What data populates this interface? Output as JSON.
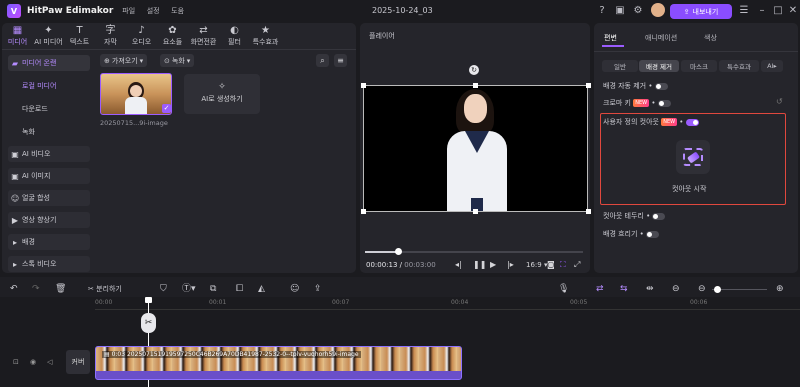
{
  "app": {
    "logo_letter": "V",
    "name": "HitPaw Edimakor",
    "menu": [
      "파일",
      "설정",
      "도움"
    ],
    "project_title": "2025-10-24_03",
    "export_label": "내보내기",
    "avatar": "avatar"
  },
  "colors": {
    "accent": "#8a4dff",
    "panel": "#25252b",
    "background": "#1b1b1f",
    "highlight_box": "#e0483e"
  },
  "toolbar": [
    {
      "label": "미디어",
      "icon": "media-icon"
    },
    {
      "label": "AI 미디어",
      "icon": "ai-media-icon"
    },
    {
      "label": "텍스트",
      "icon": "text-icon"
    },
    {
      "label": "자막",
      "icon": "subtitle-icon"
    },
    {
      "label": "오디오",
      "icon": "audio-icon"
    },
    {
      "label": "요소들",
      "icon": "elements-icon"
    },
    {
      "label": "화면전환",
      "icon": "transition-icon"
    },
    {
      "label": "필터",
      "icon": "filter-icon"
    },
    {
      "label": "특수효과",
      "icon": "effects-icon"
    }
  ],
  "sidebar": {
    "section": "미디어 온랜",
    "items": [
      "로컬 미디어",
      "다운로드",
      "녹화",
      "AI 비디오",
      "AI 이미지",
      "얼굴 합성",
      "영상 향상기",
      "배경",
      "스톡 비디오"
    ]
  },
  "media": {
    "import_label": "가져오기",
    "record_label": "녹화",
    "thumb_caption": "20250715...9i-image",
    "ai_generate_label": "AI로 생성하기"
  },
  "player": {
    "title": "플레이어",
    "time_current": "00:00:13",
    "time_total": "00:03:00",
    "aspect": "16:9",
    "progress": 0.15
  },
  "right_panel": {
    "tabs": [
      "편변",
      "애니메이션",
      "색상"
    ],
    "subtabs": [
      "일반",
      "배경 제거",
      "마스크",
      "특수효과",
      "AI"
    ],
    "auto_bg_remove": "배경 자동 제거",
    "chroma_key": "크로마 키",
    "new_badge": "NEW",
    "custom_cutout": "사용자 정의 컷아웃",
    "start_cutout": "컷아웃 시작",
    "cutout_border": "컷아웃 테두리",
    "bg_blur": "배경 흐리기"
  },
  "timeline": {
    "split_label": "분리하기",
    "ruler": [
      "00:00",
      "00:01",
      "00:07",
      "00:04",
      "00:05",
      "00:06"
    ],
    "track_label": "커버",
    "clip_label": "0:03 202507151919597250C46B269A70DB41987-2532-0--tplv-vuqhorh59i-image"
  }
}
